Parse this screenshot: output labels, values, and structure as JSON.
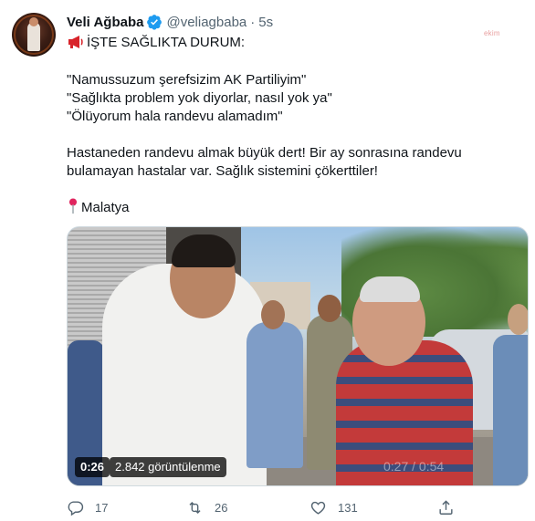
{
  "author": {
    "display_name": "Veli Ağbaba",
    "handle": "@veliagbaba",
    "separator": "·",
    "time": "5s"
  },
  "watermark": "ekim",
  "tweet": {
    "heading": "İŞTE SAĞLIKTA DURUM:",
    "quotes": [
      "\"Namussuzum şerefsizim AK Partiliyim\"",
      "\"Sağlıkta problem yok diyorlar, nasıl yok ya\"",
      "\"Ölüyorum hala randevu alamadım\""
    ],
    "paragraph_lines": [
      "Hastaneden randevu almak büyük dert! Bir ay sonrasına randevu",
      "bulamayan hastalar var. Sağlık sistemini çökerttiler!"
    ],
    "location": "Malatya"
  },
  "video": {
    "duration": "0:26",
    "views": "2.842 görüntülenme",
    "ghost_time": "0:27 / 0:54"
  },
  "actions": {
    "replies": "17",
    "retweets": "26",
    "likes": "131"
  },
  "colors": {
    "verified": "#1d9bf0",
    "muted": "#536471",
    "text": "#0f1419",
    "megaphone": "#d8232a",
    "pin": "#e0245e"
  },
  "icons": {
    "verified": "verified-badge-icon",
    "megaphone": "megaphone-icon",
    "pin": "round-pushpin-icon",
    "reply": "reply-icon",
    "retweet": "retweet-icon",
    "like": "heart-icon",
    "share": "share-icon"
  }
}
